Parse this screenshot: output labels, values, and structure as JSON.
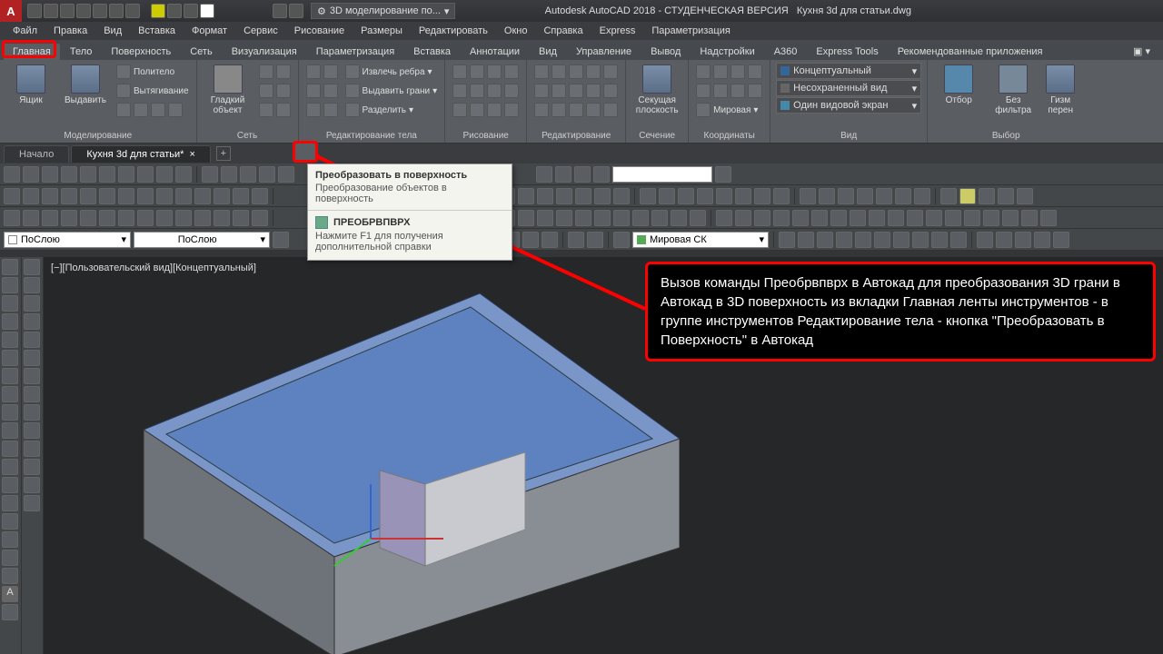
{
  "title": {
    "app": "Autodesk AutoCAD 2018 - СТУДЕНЧЕСКАЯ ВЕРСИЯ",
    "file": "Кухня 3d для статьи.dwg",
    "workspace": "3D моделирование по..."
  },
  "menu": [
    "Файл",
    "Правка",
    "Вид",
    "Вставка",
    "Формат",
    "Сервис",
    "Рисование",
    "Размеры",
    "Редактировать",
    "Окно",
    "Справка",
    "Express",
    "Параметризация"
  ],
  "ribbonTabs": [
    "Главная",
    "Тело",
    "Поверхность",
    "Сеть",
    "Визуализация",
    "Параметризация",
    "Вставка",
    "Аннотации",
    "Вид",
    "Управление",
    "Вывод",
    "Надстройки",
    "A360",
    "Express Tools",
    "Рекомендованные приложения"
  ],
  "panels": {
    "modeling": {
      "title": "Моделирование",
      "btn1": "Ящик",
      "btn2": "Выдавить",
      "i1": "Политело",
      "i2": "Вытягивание"
    },
    "mesh": {
      "title": "Сеть",
      "btn": "Гладкий\nобъект"
    },
    "solidEdit": {
      "title": "Редактирование тела",
      "i1": "Извлечь ребра",
      "i2": "Выдавить грани",
      "i3": "Разделить"
    },
    "draw": {
      "title": "Рисование"
    },
    "modify": {
      "title": "Редактирование"
    },
    "section": {
      "title": "Сечение",
      "btn": "Секущая\nплоскость"
    },
    "coords": {
      "title": "Координаты",
      "dd": "Мировая"
    },
    "view": {
      "title": "Вид",
      "d1": "Концептуальный",
      "d2": "Несохраненный вид",
      "d3": "Один видовой экран"
    },
    "selection": {
      "title": "Выбор",
      "btn1": "Отбор",
      "btn2": "Без фильтра",
      "btn3": "Гизм\nперен"
    }
  },
  "fileTabs": {
    "t1": "Начало",
    "t2": "Кухня 3d для статьи*"
  },
  "tooltip": {
    "title": "Преобразовать в поверхность",
    "desc": "Преобразование объектов в поверхность",
    "cmd": "ПРЕОБРВПВРХ",
    "help": "Нажмите F1 для получения дополнительной справки"
  },
  "layerRow": {
    "d1": "ПоСлою",
    "d2": "ПоСлою",
    "d3": "Мировая СК"
  },
  "viewLabel": "[−][Пользовательский вид][Концептуальный]",
  "callout": "Вызов команды Преобрвпврх в Автокад для преобразования 3D грани в Автокад в 3D поверхность из вкладки Главная ленты инструментов - в группе инструментов Редактирование тела - кнопка \"Преобразовать в Поверхность\" в Автокад"
}
